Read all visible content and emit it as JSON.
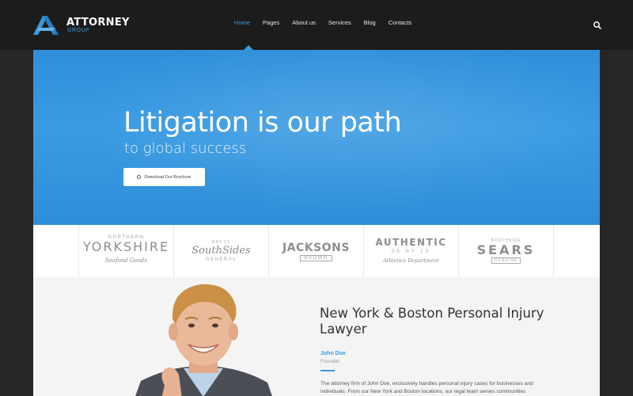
{
  "header": {
    "logo_title": "ATTORNEY",
    "logo_subtitle": "GROUP",
    "nav": [
      {
        "label": "Home",
        "active": true
      },
      {
        "label": "Pages"
      },
      {
        "label": "About us"
      },
      {
        "label": "Services"
      },
      {
        "label": "Blog"
      },
      {
        "label": "Contacts"
      }
    ],
    "search_icon": "search-icon"
  },
  "hero": {
    "title": "Litigation is our path",
    "subtitle": "to global success",
    "button_label": "Download Our Brochure",
    "button_icon": "download-icon"
  },
  "partners": [
    {
      "top": "NORTHERN",
      "main": "YORKSHIRE",
      "bottom": "Seafood Goods"
    },
    {
      "top": "EST 19",
      "main": "SouthSides",
      "bottom": "GENERAL"
    },
    {
      "top": "",
      "main": "JACKSONS",
      "bottom": "BROWN"
    },
    {
      "top": "AUTHENTIC",
      "main": "05 NY 23",
      "bottom": "Athletics Department"
    },
    {
      "top": "SOUTHSIDE",
      "main": "SEARS",
      "bottom": "GENUINE"
    }
  ],
  "about": {
    "heading": "New York & Boston Personal Injury Lawyer",
    "name": "John Doe",
    "role": "Founder",
    "text": "The attorney firm of John Doe, exclusively handles personal injury cases for businesses and individuals. From our New York and Boston locations, our legal team serves communities"
  },
  "colors": {
    "accent": "#3a9ad9",
    "header_bg": "#1c1c1c",
    "hero_bg": "#3a9be2"
  }
}
